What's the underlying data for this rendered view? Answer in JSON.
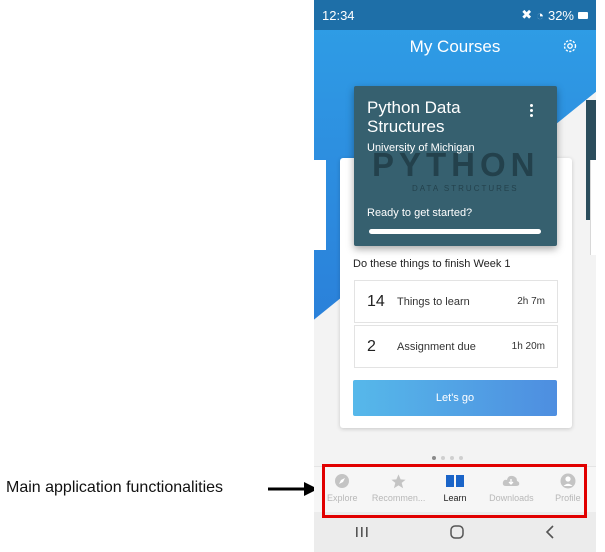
{
  "annotation": {
    "label": "Main application functionalities"
  },
  "status_bar": {
    "time": "12:34",
    "battery": "32%",
    "icons": [
      "infinity-icon",
      "mute-icon",
      "wifi-icon",
      "signal-icon",
      "battery-icon"
    ]
  },
  "header": {
    "title": "My Courses",
    "settings_icon": "gear-icon"
  },
  "course": {
    "title": "Python Data Structures",
    "school": "University of Michigan",
    "watermark": "PYTHON",
    "watermark_sub": "DATA STRUCTURES",
    "status": "Ready to get started?",
    "progress": 0
  },
  "week": {
    "heading": "Do these things to finish Week 1",
    "tasks": [
      {
        "count": "14",
        "label": "Things to learn",
        "time": "2h 7m"
      },
      {
        "count": "2",
        "label": "Assignment due",
        "time": "1h 20m"
      }
    ],
    "cta": "Let's go"
  },
  "pager": {
    "pages": 4,
    "active_index": 0
  },
  "bottom_nav": {
    "items": [
      {
        "label": "Explore",
        "icon": "compass-icon",
        "active": false
      },
      {
        "label": "Recommen...",
        "icon": "star-icon",
        "active": false
      },
      {
        "label": "Learn",
        "icon": "book-icon",
        "active": true
      },
      {
        "label": "Downloads",
        "icon": "cloud-download-icon",
        "active": false
      },
      {
        "label": "Profile",
        "icon": "profile-icon",
        "active": false
      }
    ]
  },
  "colors": {
    "header_blue": "#2d8fe0",
    "course_card": "#36606f",
    "cta_gradient": [
      "#56b8ea",
      "#4e8ee0"
    ],
    "active_nav": "#1a64c8",
    "highlight": "#e10000"
  }
}
